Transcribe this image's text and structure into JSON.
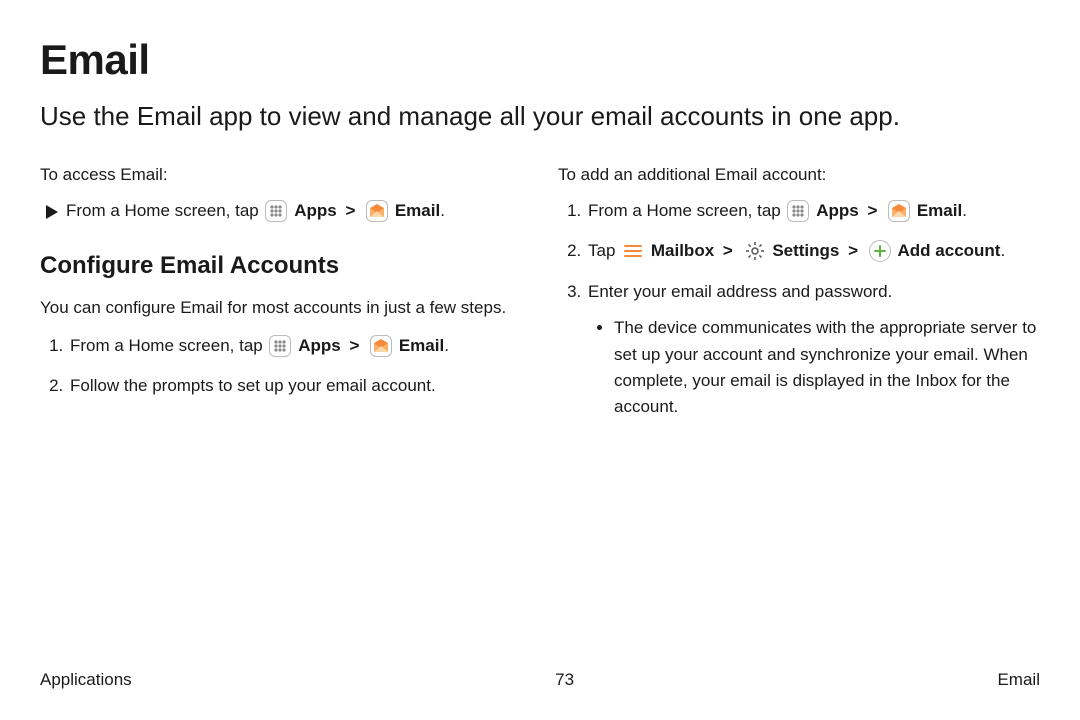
{
  "title": "Email",
  "intro": "Use the Email app to view and manage all your email accounts in one app.",
  "caret": ">",
  "labels": {
    "apps": "Apps",
    "email": "Email",
    "mailbox": "Mailbox",
    "settings": "Settings",
    "add_account": "Add account"
  },
  "left": {
    "access_label": "To access Email:",
    "access_text_prefix": "From a Home screen, tap ",
    "subhead": "Configure Email Accounts",
    "desc": "You can configure Email for most accounts in just a few steps.",
    "step1_prefix": "From a Home screen, tap ",
    "step2": "Follow the prompts to set up your email account."
  },
  "right": {
    "add_label": "To add an additional Email account:",
    "step1_prefix": "From a Home screen, tap ",
    "step2_prefix": "Tap ",
    "step3": "Enter your email address and password.",
    "step3_sub": "The device communicates with the appropriate server to set up your account and synchronize your email. When complete, your email is displayed in the Inbox for the account."
  },
  "footer": {
    "left": "Applications",
    "center": "73",
    "right": "Email"
  }
}
